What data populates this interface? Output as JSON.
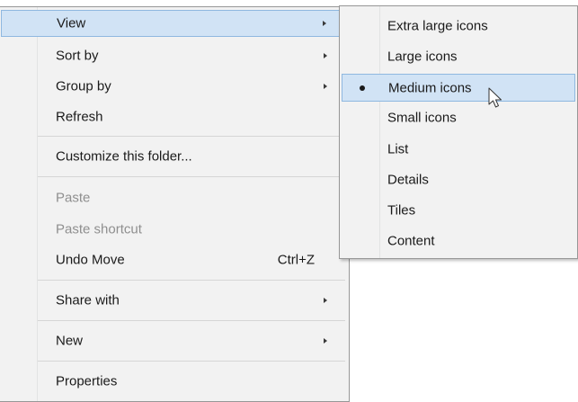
{
  "main_menu": {
    "view": "View",
    "sort_by": "Sort by",
    "group_by": "Group by",
    "refresh": "Refresh",
    "customize": "Customize this folder...",
    "paste": "Paste",
    "paste_shortcut": "Paste shortcut",
    "undo_move": "Undo Move",
    "undo_shortcut": "Ctrl+Z",
    "share_with": "Share with",
    "new": "New",
    "properties": "Properties"
  },
  "view_submenu": {
    "items": [
      "Extra large icons",
      "Large icons",
      "Medium icons",
      "Small icons",
      "List",
      "Details",
      "Tiles",
      "Content"
    ],
    "selected": "Medium icons"
  },
  "colors": {
    "menu_bg": "#f2f2f2",
    "highlight_bg": "#d1e3f5",
    "highlight_border": "#8fb8e0",
    "disabled_text": "#8f8f8f"
  },
  "icons": [
    "submenu-arrow-icon",
    "bullet-icon",
    "mouse-cursor-icon"
  ]
}
